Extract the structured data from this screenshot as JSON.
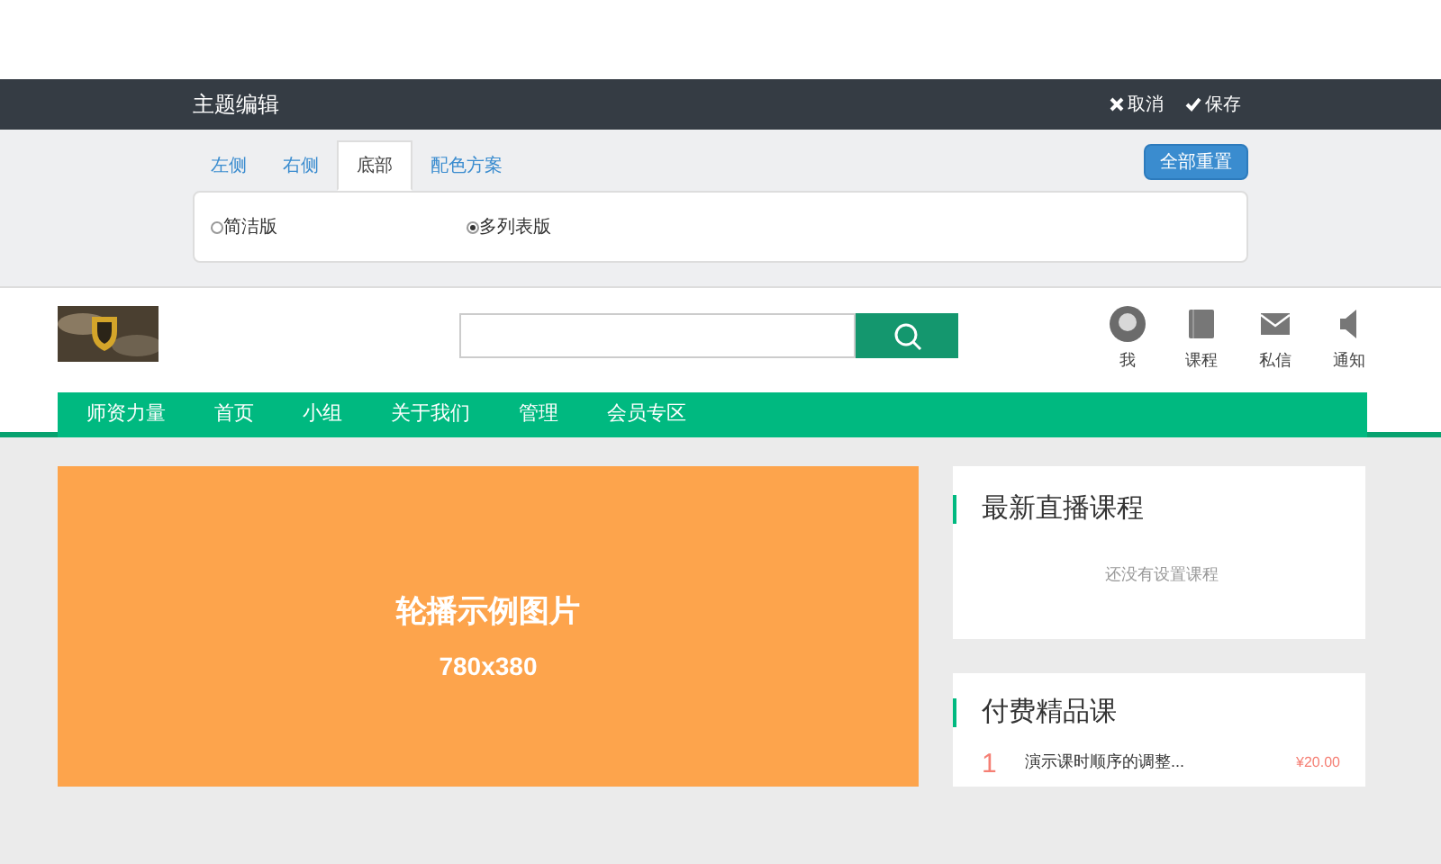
{
  "editor": {
    "title": "主题编辑",
    "actions": [
      {
        "kind": "cancel",
        "label": "取消"
      },
      {
        "kind": "save",
        "label": "保存"
      }
    ],
    "tabs": [
      {
        "label": "左侧",
        "selected": false
      },
      {
        "label": "右侧",
        "selected": false
      },
      {
        "label": "底部",
        "selected": true
      },
      {
        "label": "配色方案",
        "selected": false
      }
    ],
    "reset_button": "全部重置",
    "options": [
      {
        "label": "简洁版",
        "selected": false
      },
      {
        "label": "多列表版",
        "selected": true
      }
    ]
  },
  "header": {
    "user_links": [
      {
        "kind": "avatar",
        "label": "我"
      },
      {
        "kind": "book",
        "label": "课程"
      },
      {
        "kind": "mail",
        "label": "私信"
      },
      {
        "kind": "bell",
        "label": "通知"
      }
    ]
  },
  "nav": [
    "师资力量",
    "首页",
    "小组",
    "关于我们",
    "管理",
    "会员专区"
  ],
  "carousel": {
    "title": "轮播示例图片",
    "size": "780x380"
  },
  "live_card": {
    "title": "最新直播课程",
    "empty": "还没有设置课程"
  },
  "paid_card": {
    "title": "付费精品课",
    "items": [
      {
        "rank": "1",
        "title": "演示课时顺序的调整...",
        "price": "¥20.00"
      }
    ]
  }
}
